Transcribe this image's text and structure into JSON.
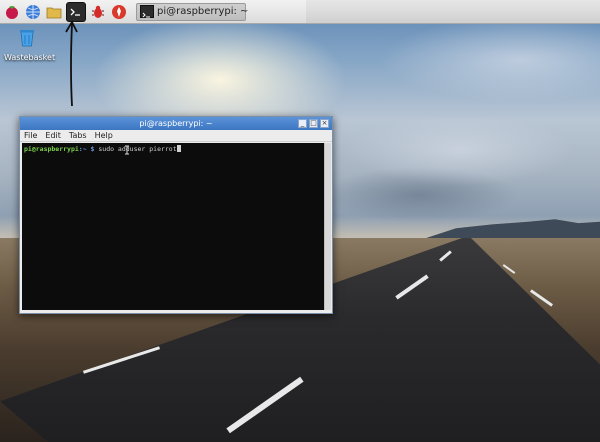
{
  "taskbar": {
    "launchers": [
      {
        "icon": "raspberry-menu-icon",
        "color": "#c51a4a"
      },
      {
        "icon": "web-browser-icon",
        "color": "#3a7bd5"
      },
      {
        "icon": "file-manager-icon",
        "color": "#e1b84a"
      },
      {
        "icon": "terminal-icon",
        "color": "#2b2b2b"
      },
      {
        "icon": "debug-bug-icon",
        "color": "#d42a2a"
      },
      {
        "icon": "wolfram-icon",
        "color": "#d8392b"
      }
    ],
    "task": {
      "label": "pi@raspberrypi: ~",
      "icon": "terminal-icon"
    }
  },
  "desktop": {
    "icons": [
      {
        "label": "Wastebasket",
        "icon": "trash-icon"
      }
    ]
  },
  "window": {
    "title": "pi@raspberrypi: ~",
    "menu": [
      "File",
      "Edit",
      "Tabs",
      "Help"
    ],
    "controls": [
      "minimize",
      "maximize",
      "close"
    ],
    "terminal": {
      "prompt_user": "pi@raspberrypi",
      "prompt_path": ":~ $",
      "command": " sudo adduser pierrot"
    }
  },
  "colors": {
    "titlebar": "#3c76c2",
    "prompt": "#7bd34b",
    "path": "#6f9be5",
    "terminal_bg": "#0c0c0c"
  }
}
